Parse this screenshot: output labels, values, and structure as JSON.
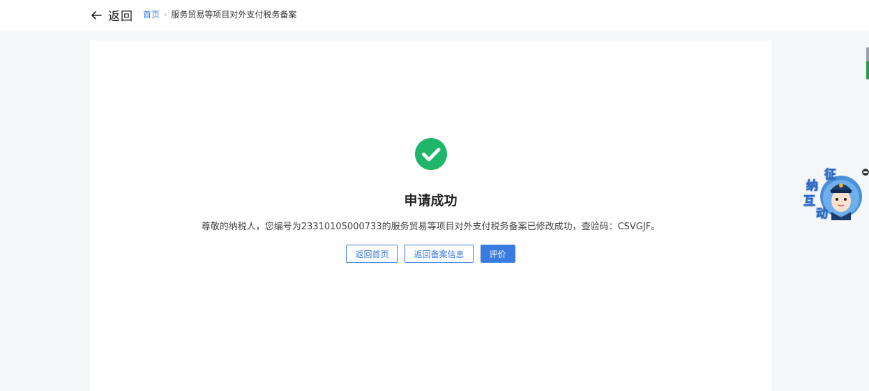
{
  "header": {
    "back_label": "返回",
    "breadcrumb": {
      "home": "首页",
      "separator": "›",
      "current": "服务贸易等项目对外支付税务备案"
    }
  },
  "result": {
    "icon": "check-circle-icon",
    "title": "申请成功",
    "message": "尊敬的纳税人，您编号为23310105000733的服务贸易等项目对外支付税务备案已修改成功，查验码：CSVGJF。",
    "buttons": {
      "home": "返回首页",
      "record_info": "返回备案信息",
      "rate": "评价"
    }
  },
  "widget": {
    "chars": [
      "征",
      "纳",
      "互",
      "动"
    ]
  },
  "colors": {
    "accent": "#3a7be0",
    "success": "#1fb56a",
    "background": "#f5f6f8"
  }
}
